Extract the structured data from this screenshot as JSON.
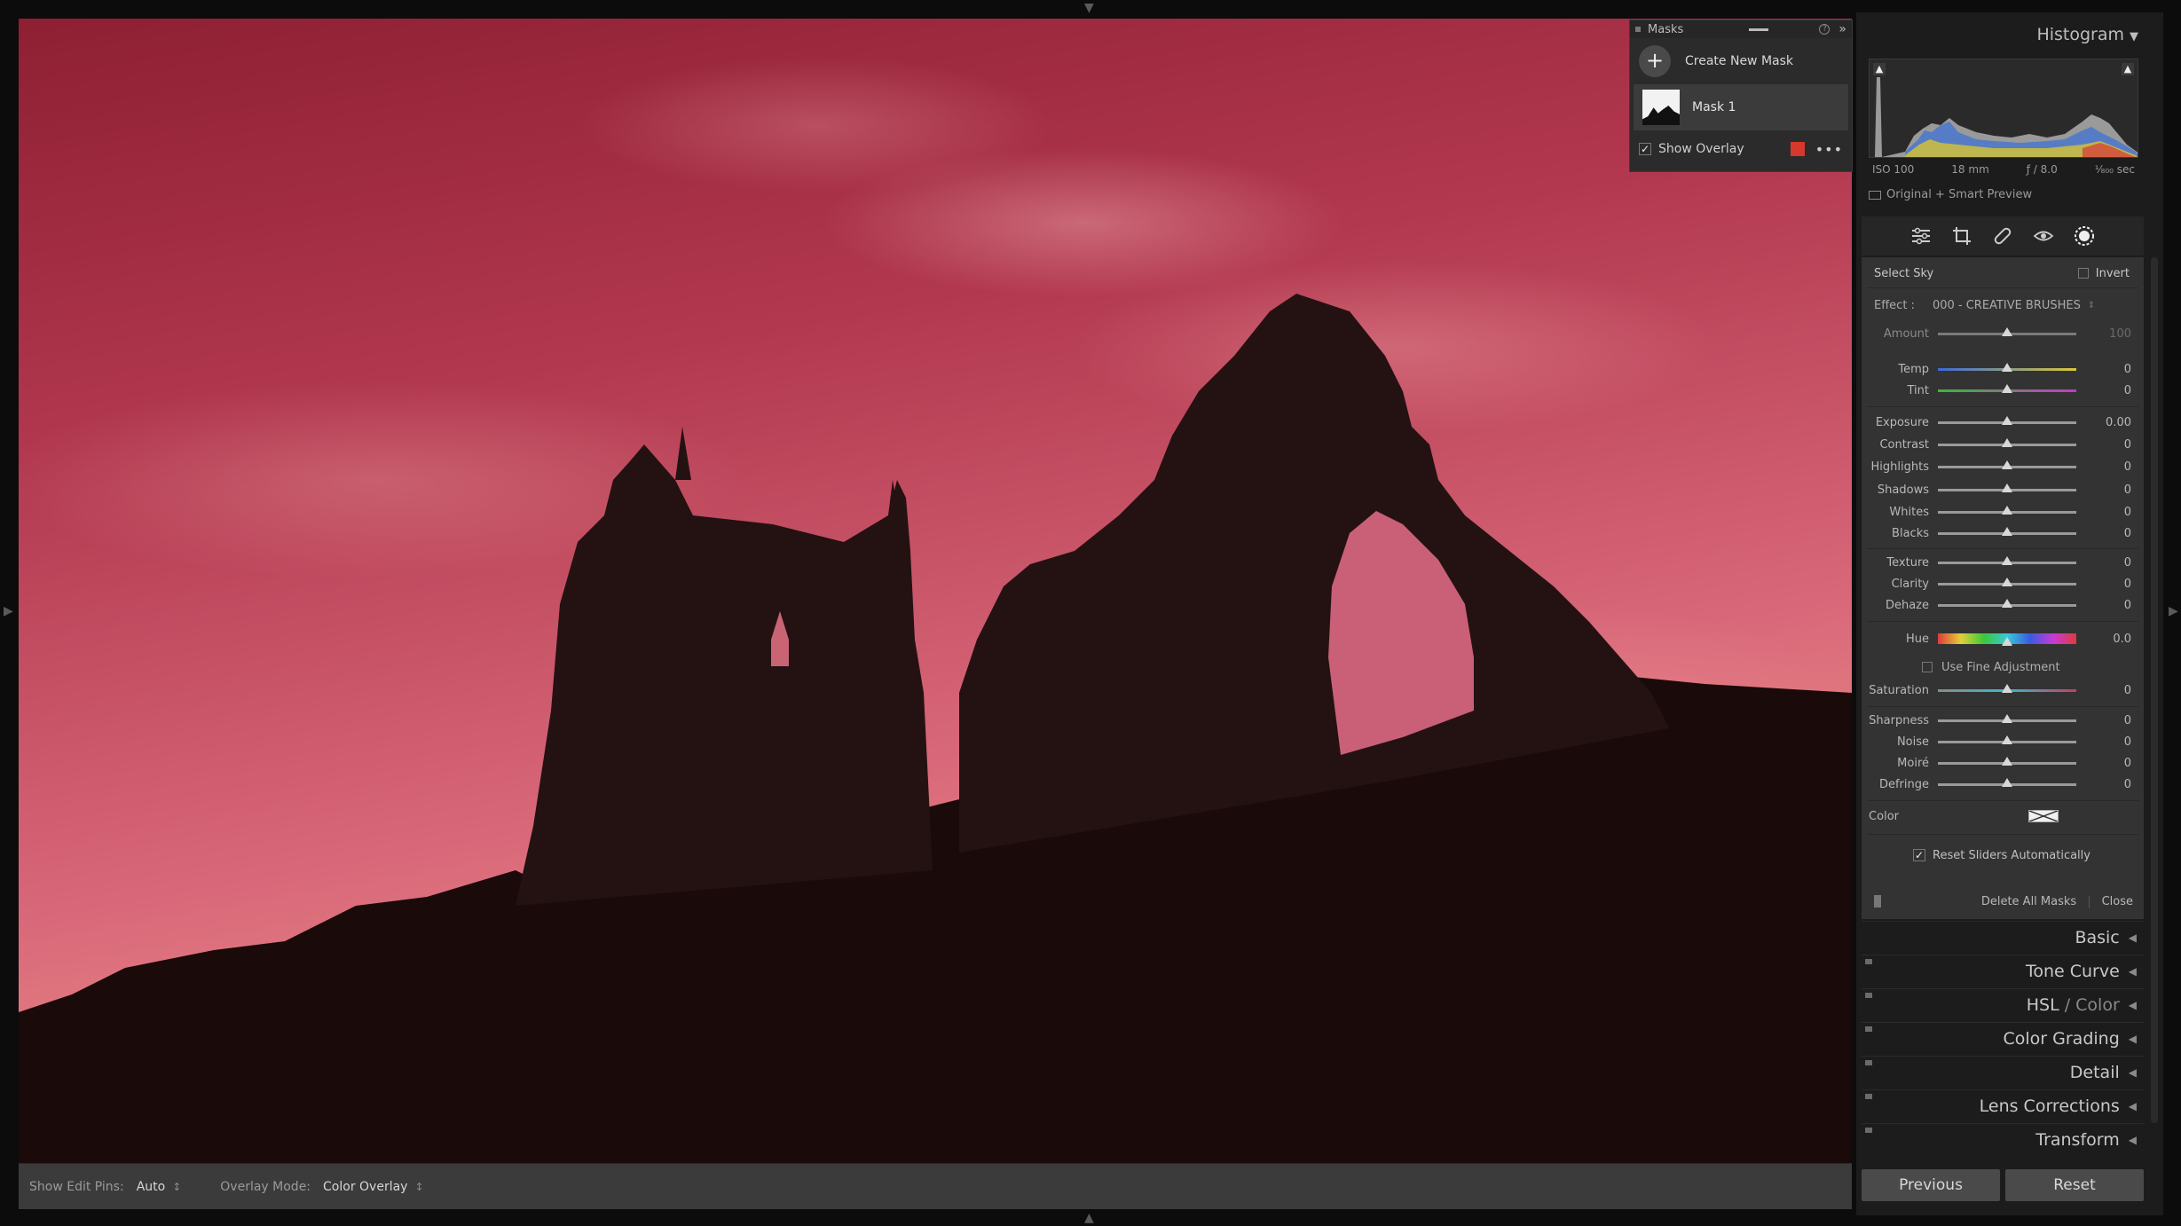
{
  "masks_panel": {
    "title": "Masks",
    "create_label": "Create New Mask",
    "mask_name": "Mask 1",
    "show_overlay_label": "Show Overlay",
    "overlay_color": "#d7382c",
    "help_icon": "?",
    "more_icon": "»",
    "dots": "•••"
  },
  "toolbar": {
    "edit_pins_label": "Show Edit Pins:",
    "edit_pins_value": "Auto",
    "overlay_mode_label": "Overlay Mode:",
    "overlay_mode_value": "Color Overlay",
    "stepper": "↕"
  },
  "histogram": {
    "title": "Histogram",
    "iso": "ISO 100",
    "focal": "18 mm",
    "aperture": "ƒ / 8.0",
    "shutter": "¹⁄₈₀₀ sec",
    "preview_label": "Original + Smart Preview"
  },
  "mask_props": {
    "select_label": "Select Sky",
    "invert_label": "Invert",
    "effect_label": "Effect :",
    "effect_value": "000 - CREATIVE BRUSHES",
    "amount": {
      "label": "Amount",
      "value": "100"
    },
    "sliders_a": [
      {
        "label": "Temp",
        "value": "0"
      },
      {
        "label": "Tint",
        "value": "0"
      }
    ],
    "sliders_b": [
      {
        "label": "Exposure",
        "value": "0.00"
      },
      {
        "label": "Contrast",
        "value": "0"
      },
      {
        "label": "Highlights",
        "value": "0"
      },
      {
        "label": "Shadows",
        "value": "0"
      },
      {
        "label": "Whites",
        "value": "0"
      },
      {
        "label": "Blacks",
        "value": "0"
      }
    ],
    "sliders_c": [
      {
        "label": "Texture",
        "value": "0"
      },
      {
        "label": "Clarity",
        "value": "0"
      },
      {
        "label": "Dehaze",
        "value": "0"
      }
    ],
    "hue": {
      "label": "Hue",
      "value": "0.0"
    },
    "fine_adjust_label": "Use Fine Adjustment",
    "saturation": {
      "label": "Saturation",
      "value": "0"
    },
    "sliders_d": [
      {
        "label": "Sharpness",
        "value": "0"
      },
      {
        "label": "Noise",
        "value": "0"
      },
      {
        "label": "Moiré",
        "value": "0"
      },
      {
        "label": "Defringe",
        "value": "0"
      }
    ],
    "color_label": "Color",
    "reset_label": "Reset Sliders Automatically",
    "delete_all_label": "Delete All Masks",
    "close_label": "Close"
  },
  "sections": [
    {
      "label": "Basic"
    },
    {
      "label": "Tone Curve"
    },
    {
      "label": "HSL",
      "suffix": "Color"
    },
    {
      "label": "Color Grading"
    },
    {
      "label": "Detail"
    },
    {
      "label": "Lens Corrections"
    },
    {
      "label": "Transform"
    }
  ],
  "buttons": {
    "previous": "Previous",
    "reset": "Reset"
  }
}
